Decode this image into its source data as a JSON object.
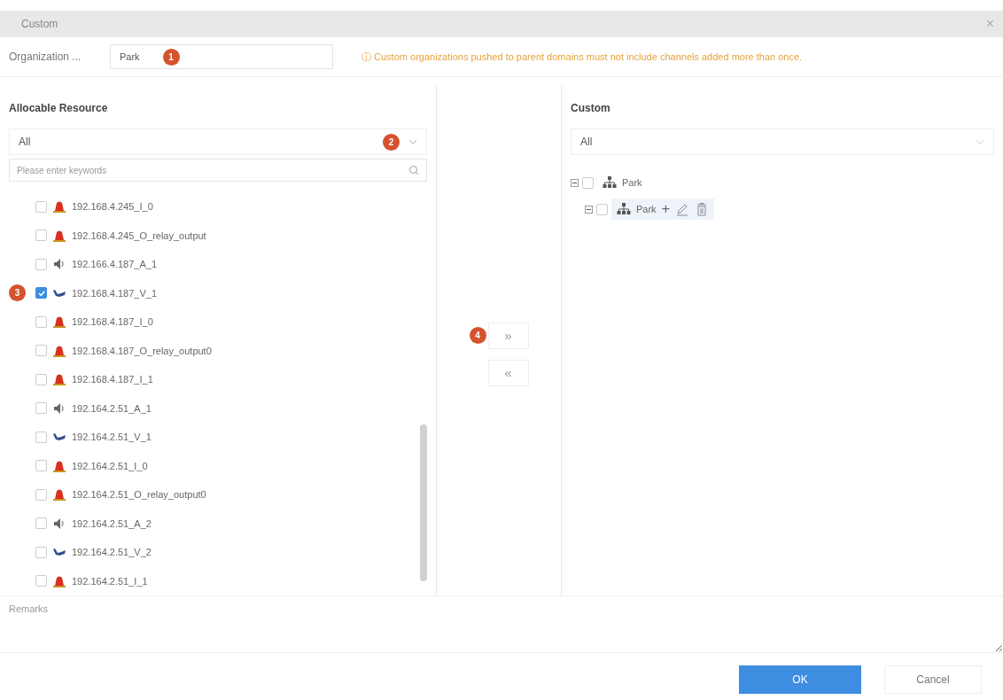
{
  "window": {
    "title": "Custom",
    "close": "×"
  },
  "organization": {
    "label": "Organization ...",
    "value": "Park",
    "badge": "1",
    "hint": "ⓘ Custom organizations pushed to parent domains must not include channels added more than once."
  },
  "left_panel": {
    "title": "Allocable Resource",
    "filter": {
      "value": "All",
      "badge": "2"
    },
    "search": {
      "placeholder": "Please enter keywords"
    },
    "items": [
      {
        "label": "192.168.4.245_I_0",
        "kind": "alarm",
        "checked": false
      },
      {
        "label": "192.168.4.245_O_relay_output",
        "kind": "alarm",
        "checked": false
      },
      {
        "label": "192.166.4.187_A_1",
        "kind": "audio",
        "checked": false
      },
      {
        "label": "192.168.4.187_V_1",
        "kind": "video",
        "checked": true,
        "badge": "3"
      },
      {
        "label": "192.168.4.187_I_0",
        "kind": "alarm",
        "checked": false
      },
      {
        "label": "192.168.4.187_O_relay_output0",
        "kind": "alarm",
        "checked": false
      },
      {
        "label": "192.168.4.187_I_1",
        "kind": "alarm",
        "checked": false
      },
      {
        "label": "192.164.2.51_A_1",
        "kind": "audio",
        "checked": false
      },
      {
        "label": "192.164.2.51_V_1",
        "kind": "video",
        "checked": false
      },
      {
        "label": "192.164.2.51_I_0",
        "kind": "alarm",
        "checked": false
      },
      {
        "label": "192.164.2.51_O_relay_output0",
        "kind": "alarm",
        "checked": false
      },
      {
        "label": "192.164.2.51_A_2",
        "kind": "audio",
        "checked": false
      },
      {
        "label": "192.164.2.51_V_2",
        "kind": "video",
        "checked": false
      },
      {
        "label": "192.164.2.51_I_1",
        "kind": "alarm",
        "checked": false
      }
    ]
  },
  "transfer": {
    "add": "»",
    "add_badge": "4",
    "remove": "«"
  },
  "right_panel": {
    "title": "Custom",
    "filter": {
      "value": "All"
    },
    "tree": [
      {
        "label": "Park",
        "expanded": true,
        "checked": false,
        "selected": false,
        "children": [
          {
            "label": "Park",
            "expanded": true,
            "checked": false,
            "selected": true,
            "actions": [
              "+"
            ]
          }
        ]
      }
    ]
  },
  "remarks": {
    "placeholder": "Remarks"
  },
  "buttons": {
    "ok": "OK",
    "cancel": "Cancel"
  }
}
